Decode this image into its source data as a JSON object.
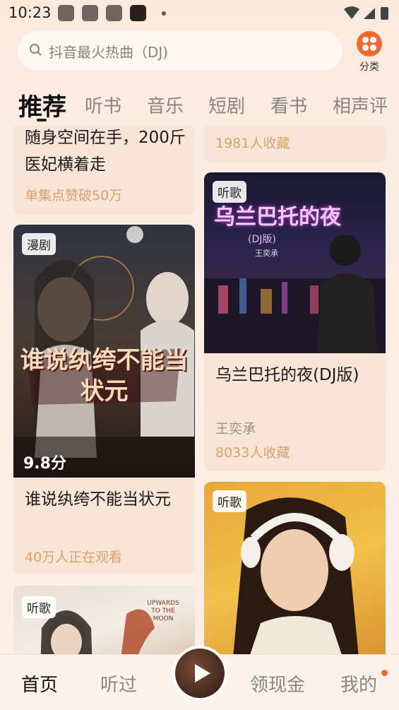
{
  "status_bar": {
    "time": "10:23"
  },
  "search": {
    "placeholder": "抖音最火热曲（DJ)"
  },
  "category": {
    "label": "分类"
  },
  "tabs": [
    "推荐",
    "听书",
    "音乐",
    "短剧",
    "看书",
    "相声评"
  ],
  "feed": {
    "left": [
      {
        "title": "随身空间在手，200斤医妃横着走",
        "meta": "单集点赞破50万"
      },
      {
        "badge": "漫剧",
        "poster_text": "谁说纨绔不能当状元",
        "score": "9.8分",
        "title": "谁说纨绔不能当状元",
        "meta": "40万人正在观看"
      },
      {
        "badge": "听歌",
        "poster_text": "UPWARDS TO THE MOON"
      }
    ],
    "right": [
      {
        "meta": "1981人收藏"
      },
      {
        "badge": "听歌",
        "poster_title": "乌兰巴托的夜",
        "poster_sub": "(DJ版)",
        "poster_artist": "王奕承",
        "title": "乌兰巴托的夜(DJ版)",
        "subtitle": "王奕承",
        "meta": "8033人收藏"
      },
      {
        "badge": "听歌"
      }
    ]
  },
  "bottom_nav": {
    "home": "首页",
    "history": "听过",
    "cash": "领现金",
    "mine": "我的"
  },
  "colors": {
    "accent": "#f06a2f",
    "meta": "#d7a36d"
  }
}
